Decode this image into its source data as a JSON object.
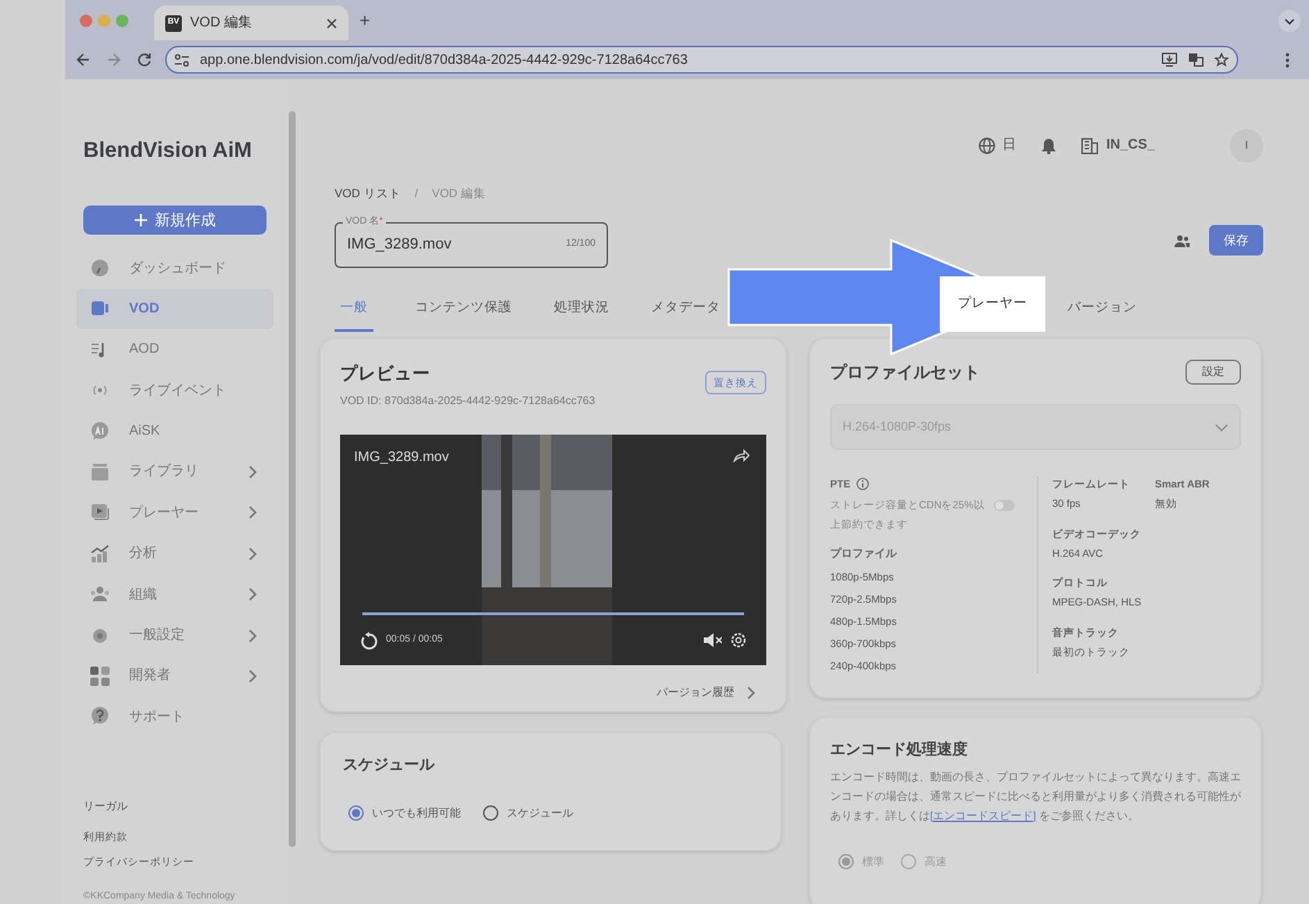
{
  "browser": {
    "tab_title": "VOD 編集",
    "tab_logo": "BV",
    "new_tab": "+",
    "url": "app.one.blendvision.com/ja/vod/edit/870d384a-2025-4442-929c-7128a64cc763"
  },
  "sidebar": {
    "logo": "BlendVision AiM",
    "create_button": "新規作成",
    "items": [
      {
        "label": "ダッシュボード",
        "selected": false,
        "expandable": false
      },
      {
        "label": "VOD",
        "selected": true,
        "expandable": false
      },
      {
        "label": "AOD",
        "selected": false,
        "expandable": false
      },
      {
        "label": "ライブイベント",
        "selected": false,
        "expandable": false
      },
      {
        "label": "AiSK",
        "selected": false,
        "expandable": false
      },
      {
        "label": "ライブラリ",
        "selected": false,
        "expandable": true
      },
      {
        "label": "プレーヤー",
        "selected": false,
        "expandable": true
      },
      {
        "label": "分析",
        "selected": false,
        "expandable": true
      },
      {
        "label": "組織",
        "selected": false,
        "expandable": true
      },
      {
        "label": "一般設定",
        "selected": false,
        "expandable": true
      },
      {
        "label": "開発者",
        "selected": false,
        "expandable": true
      },
      {
        "label": "サポート",
        "selected": false,
        "expandable": false
      }
    ],
    "footer_links": [
      "リーガル",
      "利用約款",
      "プライバシーポリシー"
    ],
    "copyright": "©KKCompany Media & Technology"
  },
  "header": {
    "language": "日",
    "org": "IN_CS_",
    "avatar": "I"
  },
  "breadcrumb": {
    "items": [
      "VOD リスト",
      "VOD 編集"
    ],
    "separator": "/"
  },
  "name_field": {
    "label": "VOD 名",
    "required_mark": "*",
    "value": "IMG_3289.mov",
    "counter": "12/100"
  },
  "save_button": "保存",
  "tabs": [
    {
      "label": "一般",
      "selected": true,
      "highlighted": false
    },
    {
      "label": "コンテンツ保護",
      "selected": false,
      "highlighted": false
    },
    {
      "label": "処理状況",
      "selected": false,
      "highlighted": false
    },
    {
      "label": "メタデータ",
      "selected": false,
      "highlighted": false
    },
    {
      "label": "プレーヤー",
      "selected": false,
      "highlighted": true
    },
    {
      "label": "バージョン",
      "selected": false,
      "highlighted": false
    }
  ],
  "preview": {
    "title": "プレビュー",
    "vod_id": "VOD ID: 870d384a-2025-4442-929c-7128a64cc763",
    "replace_button": "置き換え",
    "video_title": "IMG_3289.mov",
    "level": 1,
    "time": "00:05 / 00:05",
    "muted": true,
    "history_link": "バージョン履歴"
  },
  "profile_set": {
    "title": "プロファイルセット",
    "settings_button": "設定",
    "select_value": "H.264-1080P-30fps",
    "pte_label": "PTE",
    "pte_text": "ストレージ容量とCDNを25%以上節約できます",
    "pte_on": false,
    "profiles_label": "プロファイル",
    "profiles": [
      "1080p-5Mbps",
      "720p-2.5Mbps",
      "480p-1.5Mbps",
      "360p-700kbps",
      "240p-400kbps"
    ],
    "specs": [
      {
        "label": "フレームレート",
        "value": "30 fps"
      },
      {
        "label": "Smart ABR",
        "value": "無効"
      },
      {
        "label": "ビデオコーデック",
        "value": "H.264 AVC"
      },
      {
        "label": "プロトコル",
        "value": "MPEG-DASH, HLS"
      },
      {
        "label": "音声トラック",
        "value": "最初のトラック"
      }
    ]
  },
  "schedule": {
    "title": "スケジュール",
    "options": [
      {
        "label": "いつでも利用可能",
        "selected": true
      },
      {
        "label": "スケジュール",
        "selected": false
      }
    ]
  },
  "encode": {
    "title": "エンコード処理速度",
    "text_before": "エンコード時間は、動画の長さ、プロファイルセットによって異なります。高速エンコードの場合は、通常スピードに比べると利用量がより多く消費される可能性があります。詳しくは",
    "link": "[エンコードスピード]",
    "text_after": "をご参照ください。",
    "options": [
      {
        "label": "標準",
        "selected": true,
        "disabled": true
      },
      {
        "label": "高速",
        "selected": false,
        "disabled": true
      }
    ]
  }
}
